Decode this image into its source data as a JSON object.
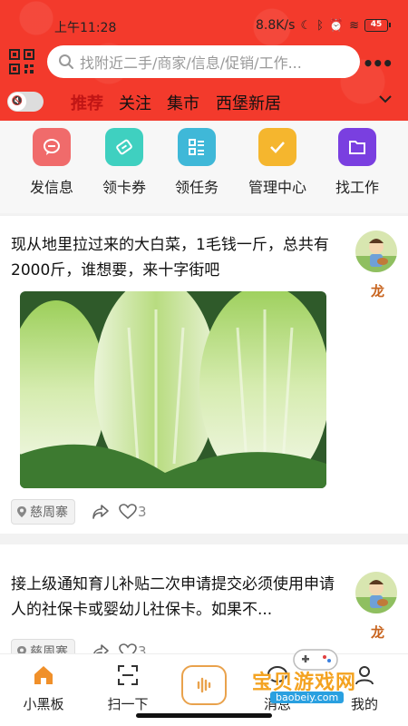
{
  "status_bar": {
    "time": "上午11:28",
    "net_speed": "8.8K/s",
    "battery_level": "45",
    "battery_color": "#e0322a"
  },
  "header": {
    "search_placeholder": "找附近二手/商家/信息/促销/工作...",
    "tabs": [
      "推荐",
      "关注",
      "集市",
      "西堡新居"
    ],
    "active_tab": "推荐",
    "accent_color": "#c01515"
  },
  "quick_actions": [
    {
      "label": "发信息",
      "icon": "message-icon",
      "color": "#f06b6b"
    },
    {
      "label": "领卡券",
      "icon": "coupon-icon",
      "color": "#3fd0c0"
    },
    {
      "label": "领任务",
      "icon": "task-list-icon",
      "color": "#3fb8d8"
    },
    {
      "label": "管理中心",
      "icon": "check-icon",
      "color": "#f5b62e"
    },
    {
      "label": "找工作",
      "icon": "folder-icon",
      "color": "#7a3fe0"
    }
  ],
  "posts": [
    {
      "text": "现从地里拉过来的大白菜，1毛钱一斤，总共有2000斤，谁想要，来十字街吧",
      "author": "龙",
      "location": "慈周寨",
      "likes": "3",
      "has_image": true
    },
    {
      "text": "接上级通知育儿补贴二次申请提交必须使用申请人的社保卡或婴幼儿社保卡。如果不...",
      "author": "龙",
      "location": "慈周寨",
      "likes": "3"
    }
  ],
  "tabbar": {
    "items": [
      {
        "label": "小黑板",
        "icon": "home-icon",
        "active": true
      },
      {
        "label": "扫一下",
        "icon": "scan-icon"
      },
      {
        "label": "消息",
        "icon": "chat-icon"
      },
      {
        "label": "我的",
        "icon": "profile-icon"
      }
    ],
    "center_button_icon": "voice-icon",
    "active_color": "#f0902a"
  },
  "watermark": {
    "title": "宝贝游戏网",
    "url": "baobeiy.com"
  }
}
